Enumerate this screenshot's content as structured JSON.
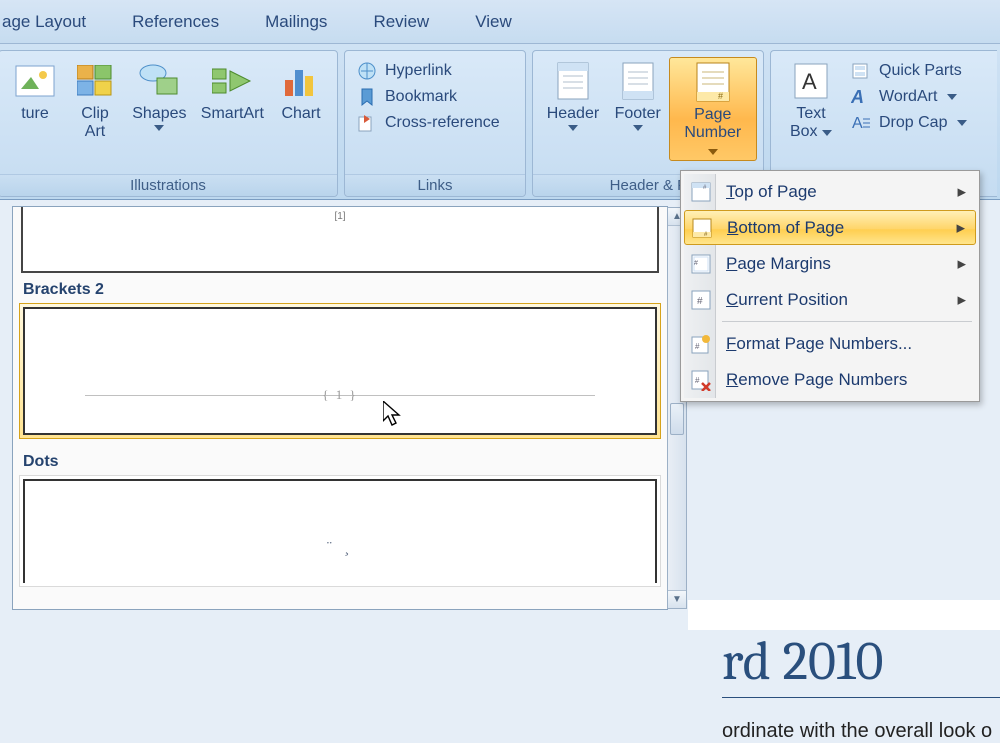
{
  "tabs": {
    "page_layout": "age Layout",
    "references": "References",
    "mailings": "Mailings",
    "review": "Review",
    "view": "View"
  },
  "ribbon": {
    "illustrations": {
      "title": "Illustrations",
      "picture": "ture",
      "clip_art_1": "Clip",
      "clip_art_2": "Art",
      "shapes": "Shapes",
      "smartart": "SmartArt",
      "chart": "Chart"
    },
    "links": {
      "title": "Links",
      "hyperlink": "Hyperlink",
      "bookmark": "Bookmark",
      "crossref": "Cross-reference"
    },
    "header_footer": {
      "title": "Header & F",
      "header": "Header",
      "footer": "Footer",
      "page_number_1": "Page",
      "page_number_2": "Number"
    },
    "text": {
      "text_box_1": "Text",
      "text_box_2": "Box",
      "quick_parts": "Quick Parts",
      "wordart": "WordArt",
      "drop_cap": "Drop Cap"
    }
  },
  "menu": {
    "top_of_page": "op of Page",
    "top_of_page_pre": "T",
    "bottom_of_page": "ottom of Page",
    "bottom_of_page_pre": "B",
    "page_margins": "age Margins",
    "page_margins_pre": "P",
    "current_position": "urrent Position",
    "current_position_pre": "C",
    "format_pre": "F",
    "format": "ormat Page Numbers...",
    "remove_pre": "R",
    "remove": "emove Page Numbers"
  },
  "gallery": {
    "tiny_header": "[1]",
    "brackets2_title": "Brackets 2",
    "brackets2_sample": "{  1  }",
    "dots_title": "Dots",
    "dots_sample": "¨ ¸"
  },
  "document": {
    "title_fragment": "rd 2010",
    "body_fragment": "ordinate with the overall look o"
  }
}
